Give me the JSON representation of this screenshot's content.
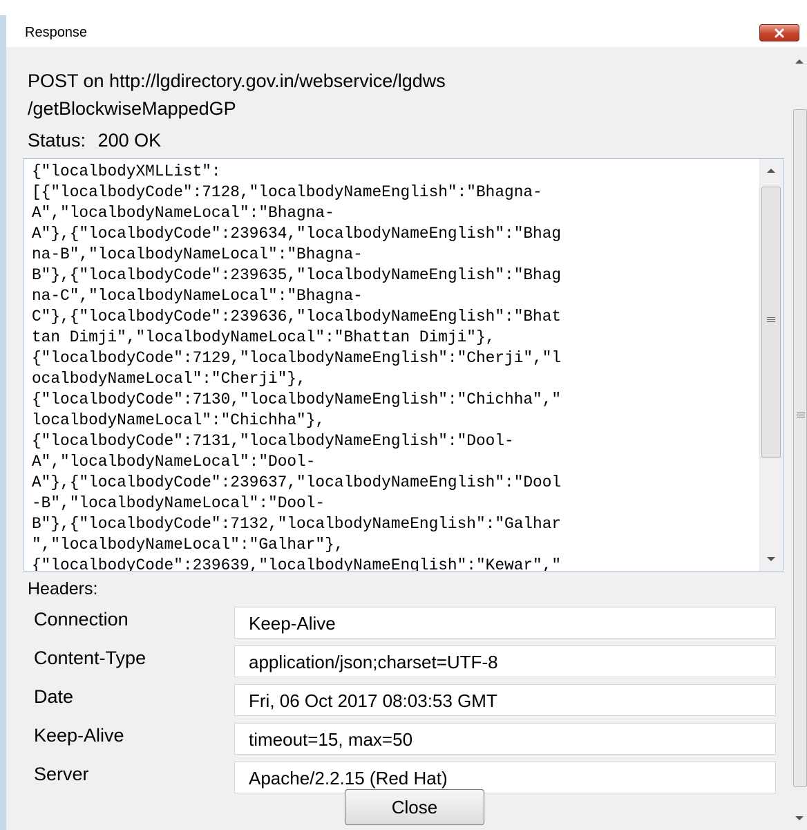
{
  "window": {
    "title": "Response"
  },
  "request": {
    "line1": "POST on http://lgdirectory.gov.in/webservice/lgdws",
    "line2": "/getBlockwiseMappedGP",
    "status_label": "Status:",
    "status_value": "200 OK"
  },
  "response_body_lines": [
    "{\"localbodyXMLList\":",
    "[{\"localbodyCode\":7128,\"localbodyNameEnglish\":\"Bhagna-",
    "A\",\"localbodyNameLocal\":\"Bhagna-",
    "A\"},{\"localbodyCode\":239634,\"localbodyNameEnglish\":\"Bhag",
    "na-B\",\"localbodyNameLocal\":\"Bhagna-",
    "B\"},{\"localbodyCode\":239635,\"localbodyNameEnglish\":\"Bhag",
    "na-C\",\"localbodyNameLocal\":\"Bhagna-",
    "C\"},{\"localbodyCode\":239636,\"localbodyNameEnglish\":\"Bhat",
    "tan Dimji\",\"localbodyNameLocal\":\"Bhattan Dimji\"},",
    "{\"localbodyCode\":7129,\"localbodyNameEnglish\":\"Cherji\",\"l",
    "ocalbodyNameLocal\":\"Cherji\"},",
    "{\"localbodyCode\":7130,\"localbodyNameEnglish\":\"Chichha\",\"",
    "localbodyNameLocal\":\"Chichha\"},",
    "{\"localbodyCode\":7131,\"localbodyNameEnglish\":\"Dool-",
    "A\",\"localbodyNameLocal\":\"Dool-",
    "A\"},{\"localbodyCode\":239637,\"localbodyNameEnglish\":\"Dool",
    "-B\",\"localbodyNameLocal\":\"Dool-",
    "B\"},{\"localbodyCode\":7132,\"localbodyNameEnglish\":\"Galhar",
    "\",\"localbodyNameLocal\":\"Galhar\"},",
    "{\"localbodyCode\":239639,\"localbodyNameEnglish\":\"Kewar\",\""
  ],
  "headers": {
    "label": "Headers:",
    "rows": [
      {
        "name": "Connection",
        "value": "Keep-Alive"
      },
      {
        "name": "Content-Type",
        "value": "application/json;charset=UTF-8"
      },
      {
        "name": "Date",
        "value": "Fri, 06 Oct 2017 08:03:53 GMT"
      },
      {
        "name": "Keep-Alive",
        "value": "timeout=15, max=50"
      },
      {
        "name": "Server",
        "value": "Apache/2.2.15 (Red Hat)"
      }
    ]
  },
  "buttons": {
    "close_label": "Close"
  },
  "icons": {
    "title_close": "close-icon"
  },
  "colors": {
    "close_button": "#c7452d",
    "frame_accent": "#c9d9ec"
  }
}
